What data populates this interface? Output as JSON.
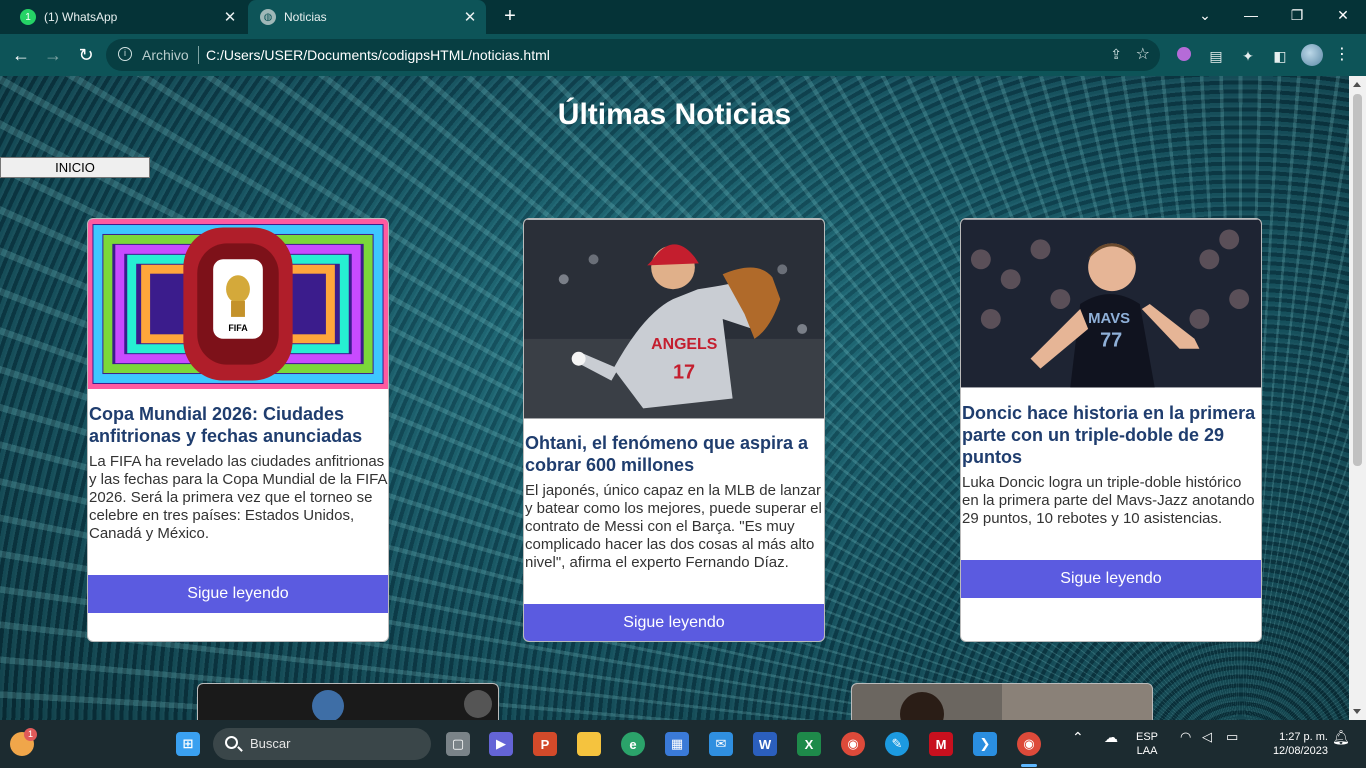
{
  "browser": {
    "tabs": [
      {
        "title": "(1) WhatsApp",
        "icon": "whatsapp-icon",
        "badge": "1"
      },
      {
        "title": "Noticias",
        "icon": "globe-icon"
      }
    ],
    "address": {
      "scheme": "Archivo",
      "url": "C:/Users/USER/Documents/codigpsHTML/noticias.html"
    }
  },
  "page": {
    "title": "Últimas Noticias",
    "nav_button": "INICIO",
    "cards": [
      {
        "title": "Copa Mundial 2026: Ciudades anfitrionas y fechas anunciadas",
        "text": "La FIFA ha revelado las ciudades anfitrionas y las fechas para la Copa Mundial de la FIFA 2026. Será la primera vez que el torneo se celebre en tres países: Estados Unidos, Canadá y México.",
        "button": "Sigue leyendo",
        "image_logo": "FIFA"
      },
      {
        "title": "Ohtani, el fenómeno que aspira a cobrar 600 millones",
        "text": "El japonés, único capaz en la MLB de lanzar y batear como los mejores, puede superar el contrato de Messi con el Barça. \"Es muy complicado hacer las dos cosas al más alto nivel\", afirma el experto Fernando Díaz.",
        "button": "Sigue leyendo",
        "image_jersey": "ANGELS",
        "image_number": "17"
      },
      {
        "title": "Doncic hace historia en la primera parte con un triple-doble de 29 puntos",
        "text": "Luka Doncic logra un triple-doble histórico en la primera parte del Mavs-Jazz anotando 29 puntos, 10 rebotes y 10 asistencias.",
        "button": "Sigue leyendo",
        "image_jersey": "MAVS",
        "image_number": "77"
      }
    ]
  },
  "taskbar": {
    "search_label": "Buscar",
    "language": "ESP",
    "layout": "LAA",
    "time": "1:27 p. m.",
    "date": "12/08/2023",
    "notification_badge": "1"
  }
}
